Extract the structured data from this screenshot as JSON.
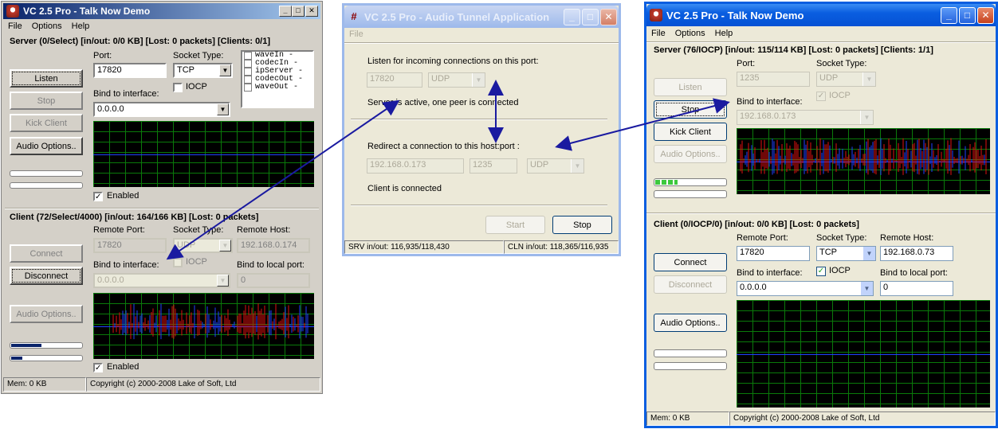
{
  "left_window": {
    "title": "VC 2.5 Pro - Talk Now Demo",
    "menu": [
      "File",
      "Options",
      "Help"
    ],
    "server": {
      "header": "Server (0/Select)  [in/out: 0/0 KB]  [Lost: 0 packets]  [Clients: 0/1]",
      "port_label": "Port:",
      "port_value": "17820",
      "socket_type_label": "Socket Type:",
      "socket_type_value": "TCP",
      "iocp_label": "IOCP",
      "bind_label": "Bind to interface:",
      "bind_value": "0.0.0.0",
      "listen_label": "Listen",
      "stop_label": "Stop",
      "kick_label": "Kick Client",
      "audio_options_label": "Audio Options..",
      "enabled_label": "Enabled",
      "codec_list": [
        "waveIn  -",
        "codecIn  -",
        "ipServer -",
        "codecOut -",
        "waveOut  -"
      ]
    },
    "client": {
      "header": "Client (72/Select/4000)  [in/out: 164/166 KB]  [Lost: 0 packets]",
      "remote_port_label": "Remote Port:",
      "remote_port_value": "17820",
      "socket_type_label": "Socket Type:",
      "socket_type_value": "UDP",
      "remote_host_label": "Remote Host:",
      "remote_host_value": "192.168.0.174",
      "iocp_label": "IOCP",
      "bind_label": "Bind to interface:",
      "bind_value": "0.0.0.0",
      "bind_local_port_label": "Bind to local port:",
      "bind_local_port_value": "0",
      "connect_label": "Connect",
      "disconnect_label": "Disconnect",
      "audio_options_label": "Audio Options..",
      "enabled_label": "Enabled"
    },
    "status": {
      "mem": "Mem: 0 KB",
      "copyright": "Copyright (c) 2000-2008 Lake of Soft, Ltd"
    }
  },
  "tunnel_window": {
    "title": "VC 2.5 Pro - Audio Tunnel Application",
    "menu": [
      "File"
    ],
    "listen_heading": "Listen for incoming connections on this port:",
    "listen_port": "17820",
    "listen_proto": "UDP",
    "server_status": "Server is active, one peer is connected",
    "redirect_heading": "Redirect a connection to this host:port :",
    "redirect_host": "192.168.0.173",
    "redirect_port": "1235",
    "redirect_proto": "UDP",
    "client_status": "Client is connected",
    "start_label": "Start",
    "stop_label": "Stop",
    "status_srv": "SRV in/out: 116,935/118,430",
    "status_cln": "CLN in/out: 118,365/116,935"
  },
  "right_window": {
    "title": "VC 2.5 Pro - Talk Now Demo",
    "menu": [
      "File",
      "Options",
      "Help"
    ],
    "server": {
      "header": "Server (76/IOCP)  [in/out: 115/114 KB]  [Lost: 0 packets]  [Clients: 1/1]",
      "port_label": "Port:",
      "port_value": "1235",
      "socket_type_label": "Socket Type:",
      "socket_type_value": "UDP",
      "iocp_label": "IOCP",
      "bind_label": "Bind to interface:",
      "bind_value": "192.168.0.173",
      "listen_label": "Listen",
      "stop_label": "Stop",
      "kick_label": "Kick Client",
      "audio_options_label": "Audio Options.."
    },
    "client": {
      "header": "Client (0/IOCP/0)  [in/out: 0/0 KB]  [Lost: 0 packets]",
      "remote_port_label": "Remote Port:",
      "remote_port_value": "17820",
      "socket_type_label": "Socket Type:",
      "socket_type_value": "TCP",
      "remote_host_label": "Remote Host:",
      "remote_host_value": "192.168.0.73",
      "iocp_label": "IOCP",
      "bind_label": "Bind to interface:",
      "bind_value": "0.0.0.0",
      "bind_local_port_label": "Bind to local port:",
      "bind_local_port_value": "0",
      "connect_label": "Connect",
      "disconnect_label": "Disconnect",
      "audio_options_label": "Audio Options.."
    },
    "status": {
      "mem": "Mem: 0 KB",
      "copyright": "Copyright (c) 2000-2008 Lake of Soft, Ltd"
    }
  },
  "colors": {
    "xp_title": "#0a5ee0",
    "scope_grid": "#0a7a0a",
    "arrow": "#1a1aa0",
    "signal_red": "#e01010",
    "signal_blue": "#2040ff"
  }
}
